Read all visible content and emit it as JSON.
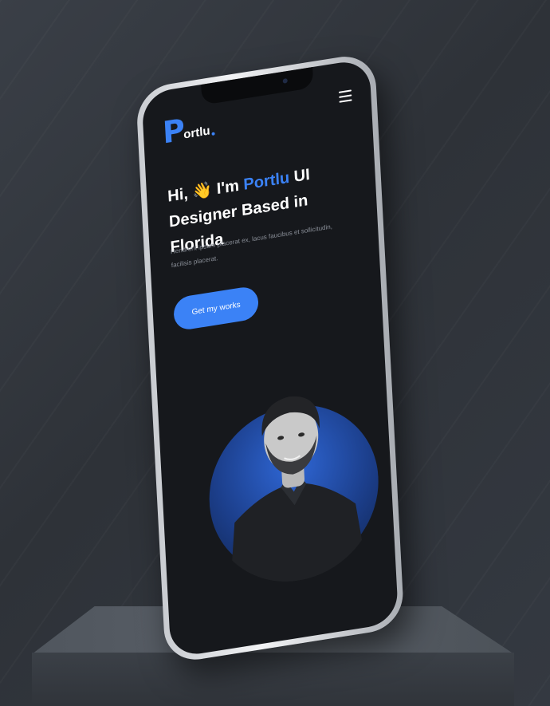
{
  "app": {
    "brand_text": "ortlu",
    "brand_mark": "P"
  },
  "hero": {
    "greeting": "Hi,",
    "wave_icon": "waving-hand-icon",
    "intro": "I'm",
    "name": "Portlu",
    "role_line1": "UI",
    "role_line2": "Designer Based in Florida",
    "description": "Hendrerit ipsum placerat ex, lacus faucibus et sollicitudin, facilisis placerat.",
    "cta_label": "Get my works"
  },
  "colors": {
    "accent": "#3b82f6",
    "screen_bg": "#16181c",
    "background": "#2e3238"
  },
  "icons": {
    "menu": "hamburger-menu-icon"
  }
}
